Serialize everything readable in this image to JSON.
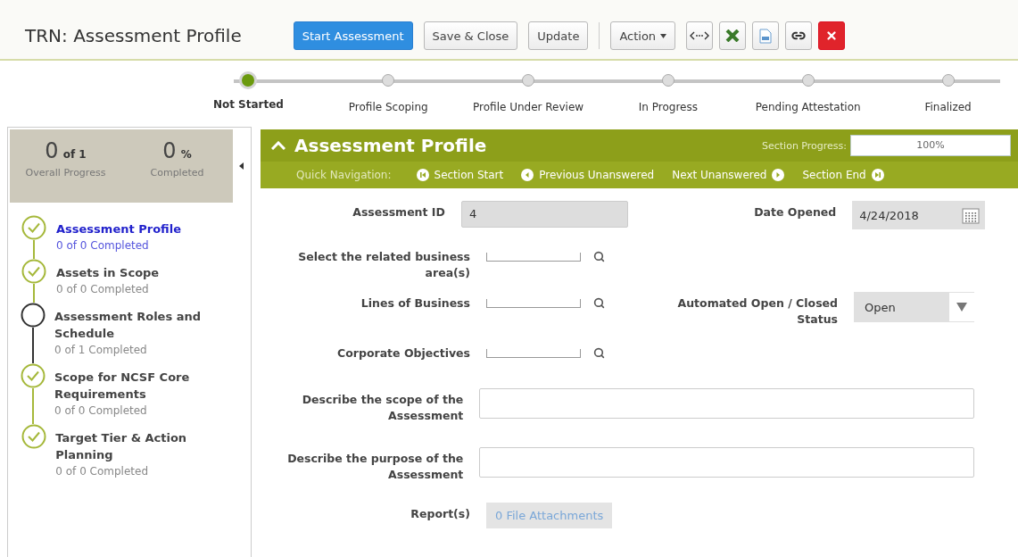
{
  "header": {
    "title": "TRN: Assessment Profile",
    "buttons": [
      {
        "label": "Start Assessment",
        "kind": "primary"
      },
      {
        "label": "Save & Close",
        "kind": "default"
      },
      {
        "label": "Update",
        "kind": "default"
      },
      {
        "label": "Action",
        "kind": "dropdown"
      }
    ]
  },
  "stepper": [
    {
      "label": "Not Started",
      "selected": true
    },
    {
      "label": "Profile Scoping",
      "selected": false
    },
    {
      "label": "Profile Under Review",
      "selected": false
    },
    {
      "label": "In Progress",
      "selected": false
    },
    {
      "label": "Pending Attestation",
      "selected": false
    },
    {
      "label": "Finalized",
      "selected": false
    }
  ],
  "summary": {
    "count": "0",
    "count_suffix": "of 1",
    "count_label": "Overall Progress",
    "percent": "0",
    "percent_suffix": "%",
    "percent_label": "Completed"
  },
  "sections": [
    {
      "title": "Assessment Profile",
      "progress": "0 of 0 Completed",
      "kind": "complete",
      "selected": true
    },
    {
      "title": "Assets in Scope",
      "progress": "0 of 0 Completed",
      "kind": "complete",
      "selected": false
    },
    {
      "title": "Assessment Roles and Schedule",
      "progress": "0 of 1 Completed",
      "kind": "incomplete",
      "selected": false
    },
    {
      "title": "Scope for NCSF Core Requirements",
      "progress": "0 of 0 Completed",
      "kind": "complete",
      "selected": false
    },
    {
      "title": "Target Tier & Action Planning",
      "progress": "0 of 0 Completed",
      "kind": "complete",
      "selected": false
    }
  ],
  "panel": {
    "title": "Assessment Profile",
    "progress_label": "Section Progress:",
    "progress_value": "100%",
    "level": 1,
    "quick_nav_label": "Quick Navigation:",
    "nav": [
      {
        "label": "Section Start",
        "kind": "start"
      },
      {
        "label": "Previous Unanswered",
        "kind": "prev"
      },
      {
        "label": "Next Unanswered",
        "kind": "next"
      },
      {
        "label": "Section End",
        "kind": "end"
      }
    ]
  },
  "form": [
    {
      "left": {
        "label": "Assessment ID",
        "kind": "text",
        "value": "4"
      },
      "right": {
        "label": "Date Opened",
        "kind": "date",
        "value": "4/24/2018"
      }
    },
    {
      "left": {
        "label": "Select the related business area(s)",
        "kind": "lookup"
      }
    },
    {
      "left": {
        "label": "Lines of Business",
        "kind": "lookup"
      },
      "right": {
        "label": "Automated Open / Closed Status",
        "kind": "select",
        "value": "Open"
      }
    },
    {
      "left": {
        "label": "Corporate Objectives",
        "kind": "lookup"
      }
    },
    {
      "left": {
        "label": "Describe the scope of the Assessment",
        "kind": "textarea"
      }
    },
    {
      "left": {
        "label": "Describe the purpose of the Assessment",
        "kind": "textarea"
      }
    },
    {
      "left": {
        "label": "Report(s)",
        "kind": "attachments",
        "value": "0 File Attachments"
      }
    }
  ]
}
